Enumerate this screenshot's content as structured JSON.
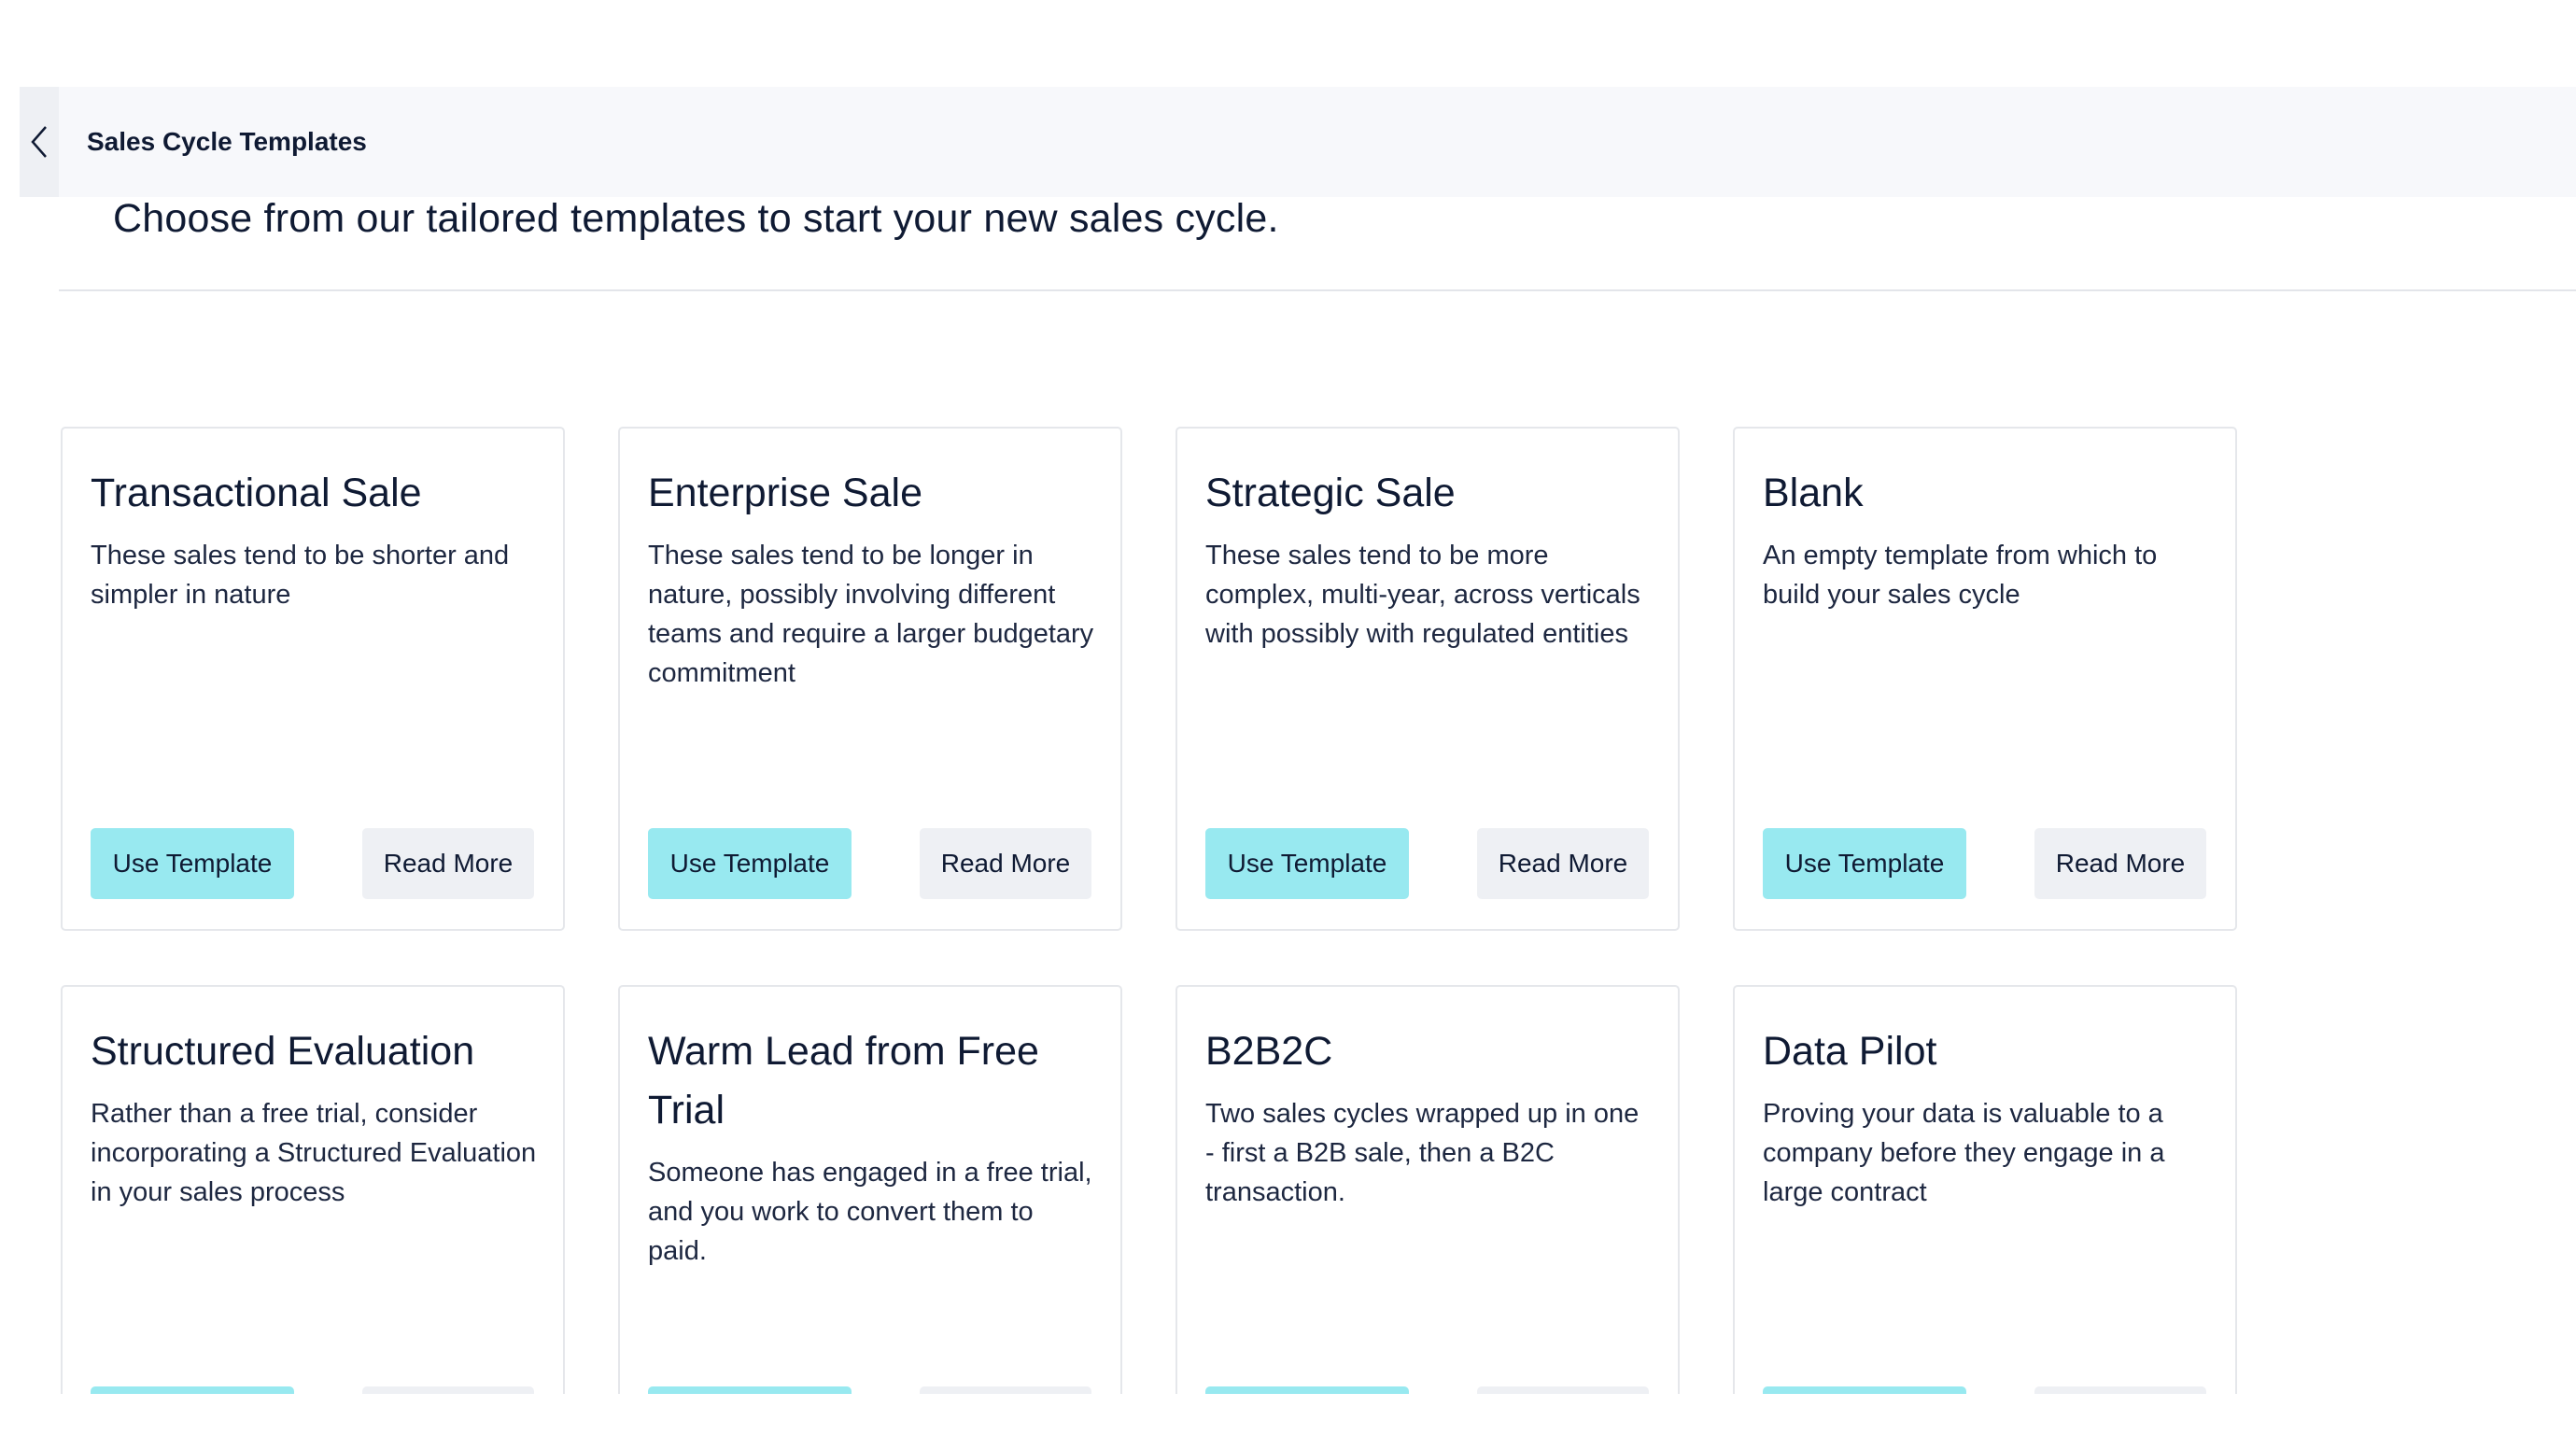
{
  "header": {
    "title": "Sales Cycle Templates",
    "back_icon": "chevron-left-icon"
  },
  "subtitle": "Choose from our tailored templates to start your new sales cycle.",
  "colors": {
    "use_button": "#98e9f0",
    "read_button": "#eef0f4",
    "text": "#0f1a33"
  },
  "buttons": {
    "use_label": "Use Template",
    "read_label": "Read More"
  },
  "templates": [
    {
      "title": "Transactional Sale",
      "description": "These sales tend to be shorter and simpler in nature"
    },
    {
      "title": "Enterprise Sale",
      "description": "These sales tend to be longer in nature, possibly involving different teams and require a larger budgetary commitment"
    },
    {
      "title": "Strategic Sale",
      "description": "These sales tend to be more complex, multi-year, across verticals with possibly with regulated entities"
    },
    {
      "title": "Blank",
      "description": "An empty template from which to build your sales cycle"
    },
    {
      "title": "Structured Evaluation",
      "description": "Rather than a free trial, consider incorporating a Structured Evaluation in your sales process"
    },
    {
      "title": "Warm Lead from Free Trial",
      "description": "Someone has engaged in a free trial, and you work to convert them to paid."
    },
    {
      "title": "B2B2C",
      "description": "Two sales cycles wrapped up in one - first a B2B sale, then a B2C transaction."
    },
    {
      "title": "Data Pilot",
      "description": "Proving your data is valuable to a company before they engage in a large contract"
    }
  ]
}
